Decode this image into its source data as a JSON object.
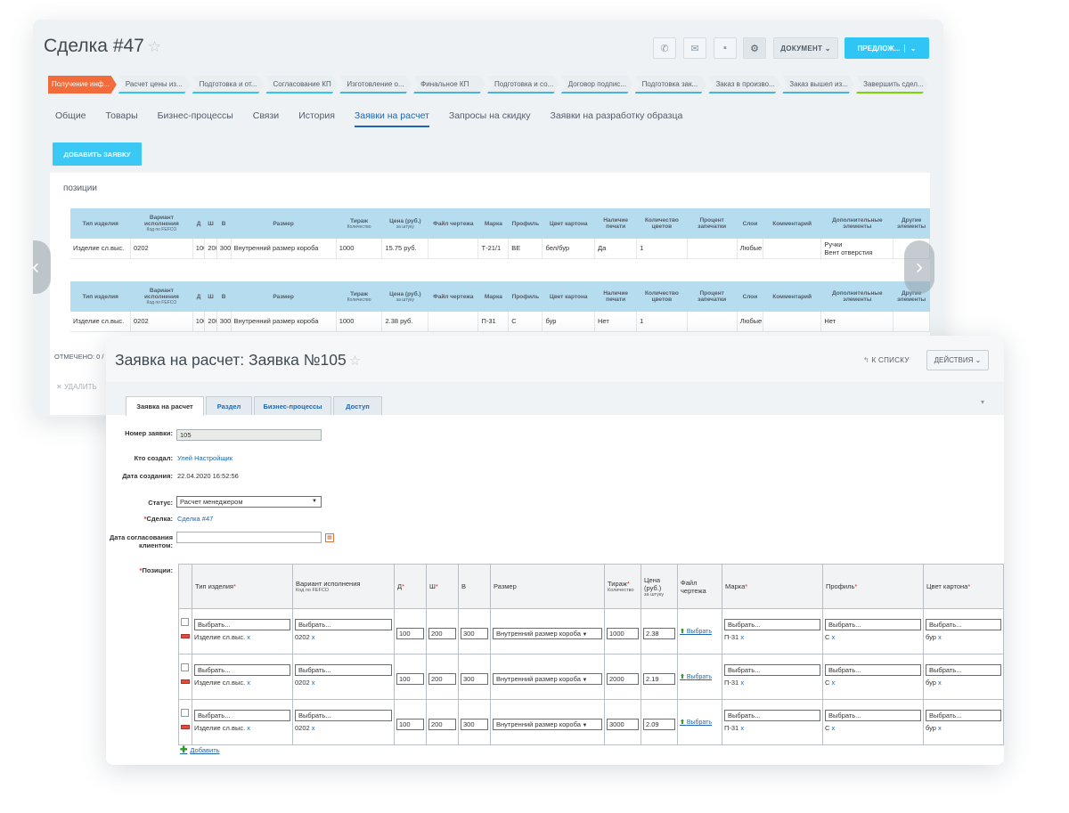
{
  "deal": {
    "title": "Сделка #47",
    "buttons": {
      "document": "ДОКУМЕНТ",
      "proposal": "ПРЕДЛОЖ..."
    },
    "stages": [
      {
        "label": "Получение инф...",
        "color": "#f26b3a"
      },
      {
        "label": "Расчет цены из...",
        "color": "#2fc6f6"
      },
      {
        "label": "Подготовка и от...",
        "color": "#2fc6f6"
      },
      {
        "label": "Согласование КП",
        "color": "#2fc6f6"
      },
      {
        "label": "Изготовление о...",
        "color": "#47b0e5"
      },
      {
        "label": "Финальное КП",
        "color": "#47b0e5"
      },
      {
        "label": "Подготовка и со...",
        "color": "#47b0e5"
      },
      {
        "label": "Договор подпис...",
        "color": "#47b0e5"
      },
      {
        "label": "Подготовка зак...",
        "color": "#47b0e5"
      },
      {
        "label": "Заказ в произво...",
        "color": "#47b0e5"
      },
      {
        "label": "Заказ вышел из...",
        "color": "#47b0e5"
      },
      {
        "label": "Завершить сдел...",
        "color": "#7bd500"
      }
    ],
    "tabs": [
      "Общие",
      "Товары",
      "Бизнес-процессы",
      "Связи",
      "История",
      "Заявки на расчет",
      "Запросы на скидку",
      "Заявки на разработку образца"
    ],
    "active_tab": "Заявки на расчет",
    "add_button": "ДОБАВИТЬ ЗАЯВКУ",
    "positions_label": "позиции",
    "table_headers": [
      "Тип изделия",
      "Вариант исполнения",
      "Д",
      "Ш",
      "В",
      "Размер",
      "Тираж",
      "Цена (руб.)",
      "Файл чертежа",
      "Марка",
      "Профиль",
      "Цвет картона",
      "Наличие печати",
      "Количество цветов",
      "Процент запечатки",
      "Слои",
      "Комментарий",
      "Дополнительные элементы",
      "Другие элементы"
    ],
    "header_subs": {
      "variant": "Код по FEFCO",
      "tirazh": "Количество",
      "price": "за штуку"
    },
    "table1_row": [
      "Изделие сл.выс.",
      "0202",
      "100",
      "200",
      "300",
      "Внутренний размер короба",
      "1000",
      "15.75 руб.",
      "",
      "Т-21/1",
      "ВЕ",
      "бел/бур",
      "Да",
      "1",
      "",
      "Любые",
      "",
      "Ручки\nВент отверстия",
      ""
    ],
    "table2_row": [
      "Изделие сл.выс.",
      "0202",
      "100",
      "200",
      "300",
      "Внутренний размер короба",
      "1000",
      "2.38 руб.",
      "",
      "П-31",
      "С",
      "бур",
      "Нет",
      "1",
      "",
      "Любые",
      "",
      "Нет",
      ""
    ],
    "checked_label": "ОТМЕЧЕНО: 0 /",
    "delete_label": "УДАЛИТЬ"
  },
  "request": {
    "title": "Заявка на расчет: Заявка №105",
    "to_list": "К СПИСКУ",
    "actions": "ДЕЙСТВИЯ",
    "tabs": [
      "Заявка на расчет",
      "Раздел",
      "Бизнес-процессы",
      "Доступ"
    ],
    "fields": {
      "number_label": "Номер заявки:",
      "number_value": "105",
      "creator_label": "Кто создал:",
      "creator_value": "Улей Настройщик",
      "created_label": "Дата создания:",
      "created_value": "22.04.2020 16:52:56",
      "status_label": "Статус:",
      "status_value": "Расчет менеджером",
      "deal_label": "Сделка:",
      "deal_value": "Сделка #47",
      "approval_label": "Дата согласования клиентом:",
      "approval_value": "",
      "positions_label": "Позиции:"
    },
    "grid_headers": {
      "type": "Тип изделия",
      "variant": "Вариант исполнения",
      "variant_sub": "Код по FEFCO",
      "d": "Д",
      "w": "Ш",
      "h": "В",
      "size": "Размер",
      "tirazh": "Тираж",
      "tirazh_sub": "Количество",
      "price": "Цена (руб.)",
      "price_sub": "за штуку",
      "file": "Файл чертежа",
      "brand": "Марка",
      "profile": "Профиль",
      "color": "Цвет картона"
    },
    "select_placeholder": "Выбрать...",
    "rows": [
      {
        "type": "Изделие сл.выс.",
        "variant": "0202",
        "d": "100",
        "w": "200",
        "h": "300",
        "size": "Внутренний размер короба",
        "tirazh": "1000",
        "price": "2.38",
        "file": "Выбрать",
        "brand": "П-31",
        "profile": "С",
        "color": "бур"
      },
      {
        "type": "Изделие сл.выс.",
        "variant": "0202",
        "d": "100",
        "w": "200",
        "h": "300",
        "size": "Внутренний размер короба",
        "tirazh": "2000",
        "price": "2.19",
        "file": "Выбрать",
        "brand": "П-31",
        "profile": "С",
        "color": "бур"
      },
      {
        "type": "Изделие сл.выс.",
        "variant": "0202",
        "d": "100",
        "w": "200",
        "h": "300",
        "size": "Внутренний размер короба",
        "tirazh": "3000",
        "price": "2.09",
        "file": "Выбрать",
        "brand": "П-31",
        "profile": "С",
        "color": "бур"
      }
    ],
    "add_label": "Добавить"
  }
}
